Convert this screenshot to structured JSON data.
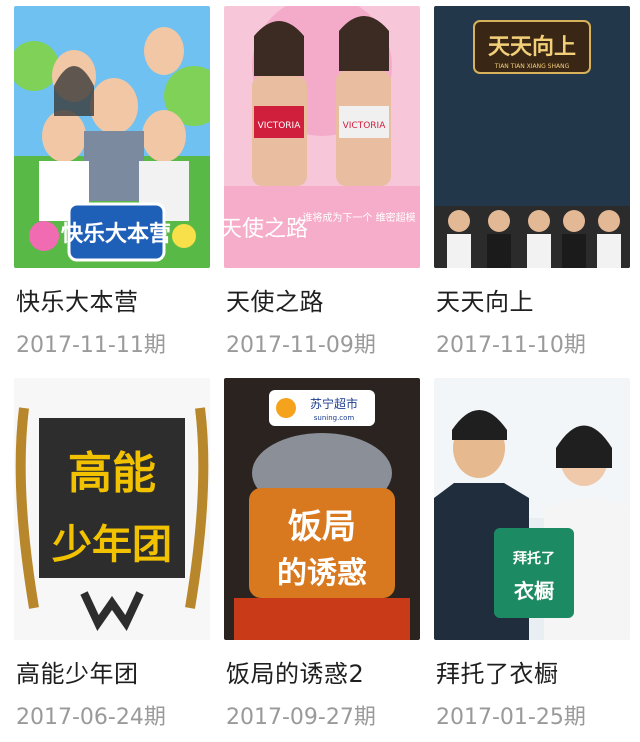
{
  "shows": [
    {
      "title": "快乐大本营",
      "date": "2017-11-11期",
      "poster_text": "快乐大本营",
      "accent": "#3aa83a"
    },
    {
      "title": "天使之路",
      "date": "2017-11-09期",
      "poster_text": "天使之路",
      "poster_brand": "VICTORIA",
      "poster_subtext": "谁将成为下一个 维密超模",
      "accent": "#e0307a"
    },
    {
      "title": "天天向上",
      "date": "2017-11-10期",
      "poster_text": "天天向上",
      "poster_subtext": "TIAN TIAN XIANG SHANG",
      "accent": "#2e4a5f"
    },
    {
      "title": "高能少年团",
      "date": "2017-06-24期",
      "poster_text": "高能少年团",
      "accent": "#f2c200"
    },
    {
      "title": "饭局的诱惑2",
      "date": "2017-09-27期",
      "poster_text": "饭局的诱惑",
      "poster_brand": "苏宁超市",
      "poster_subtext": "suning.com",
      "accent": "#e8731d"
    },
    {
      "title": "拜托了衣橱",
      "date": "2017-01-25期",
      "poster_text": "拜托了衣橱",
      "accent": "#1c8a63"
    }
  ]
}
